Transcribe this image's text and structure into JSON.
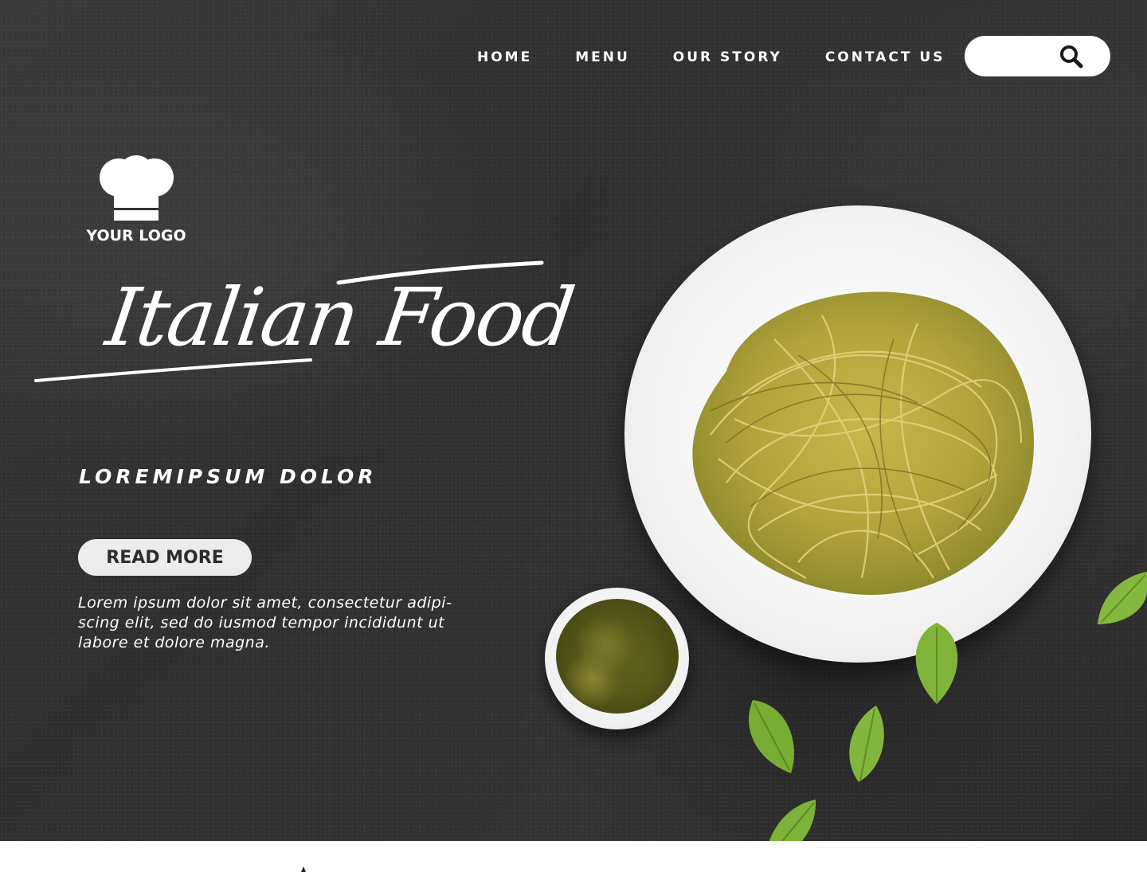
{
  "nav": {
    "items": [
      "HOME",
      "MENU",
      "OUR STORY",
      "CONTACT US"
    ]
  },
  "search": {
    "placeholder": "",
    "icon": "search-icon"
  },
  "logo": {
    "icon": "chef-hat-icon",
    "text": "YOUR LOGO"
  },
  "hero": {
    "title": "Italian Food",
    "subtitle": "LOREMIPSUM DOLOR",
    "button_label": "READ MORE",
    "body": "Lorem ipsum dolor sit amet, consectetur adipi-scing elit, sed do iusmod tempor incididunt ut labore et dolore magna."
  },
  "colors": {
    "background": "#333333",
    "text": "#ffffff",
    "button_bg": "#ececec",
    "button_text": "#2d2d2d",
    "leaf": "#7fb33a"
  }
}
